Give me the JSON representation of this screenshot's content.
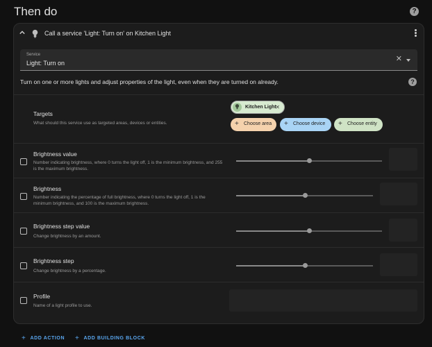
{
  "page": {
    "title": "Then do"
  },
  "card": {
    "title": "Call a service 'Light: Turn on' on Kitchen Light",
    "service_label": "Service",
    "service_value": "Light: Turn on",
    "description": "Turn on one or more lights and adjust properties of the light, even when they are turned on already."
  },
  "targets": {
    "title": "Targets",
    "description": "What should this service use as targeted areas, devices or entities.",
    "selected_entity": "Kitchen Light",
    "choose_area": "Choose area",
    "choose_device": "Choose device",
    "choose_entity": "Choose entity"
  },
  "rows": [
    {
      "title": "Brightness value",
      "desc": "Number indicating brightness, where 0 turns the light off, 1 is the minimum brightness, and 255 is the maximum brightness.",
      "slider_fraction": 0.5
    },
    {
      "title": "Brightness",
      "desc": "Number indicating the percentage of full brightness, where 0 turns the light off, 1 is the minimum brightness, and 100 is the maximum brightness.",
      "slider_fraction": 0.5
    },
    {
      "title": "Brightness step value",
      "desc": "Change brightness by an amount.",
      "slider_fraction": 0.5
    },
    {
      "title": "Brightness step",
      "desc": "Change brightness by a percentage.",
      "slider_fraction": 0.5
    },
    {
      "title": "Profile",
      "desc": "Name of a light profile to use."
    }
  ],
  "footer": {
    "add_action": "ADD ACTION",
    "add_building_block": "ADD BUILDING BLOCK"
  },
  "icons": {
    "help": "help-circle-icon",
    "chevron": "chevron-up-icon",
    "bulb": "lightbulb-icon",
    "menu": "dots-vertical-icon",
    "clear": "close-icon",
    "dropdown": "menu-down-icon",
    "plus": "plus-icon"
  },
  "colors": {
    "accent": "#5aa7f0",
    "chip_area": "#f5d2ad",
    "chip_device": "#a9d4f5",
    "chip_entity": "#cfe3c5"
  }
}
